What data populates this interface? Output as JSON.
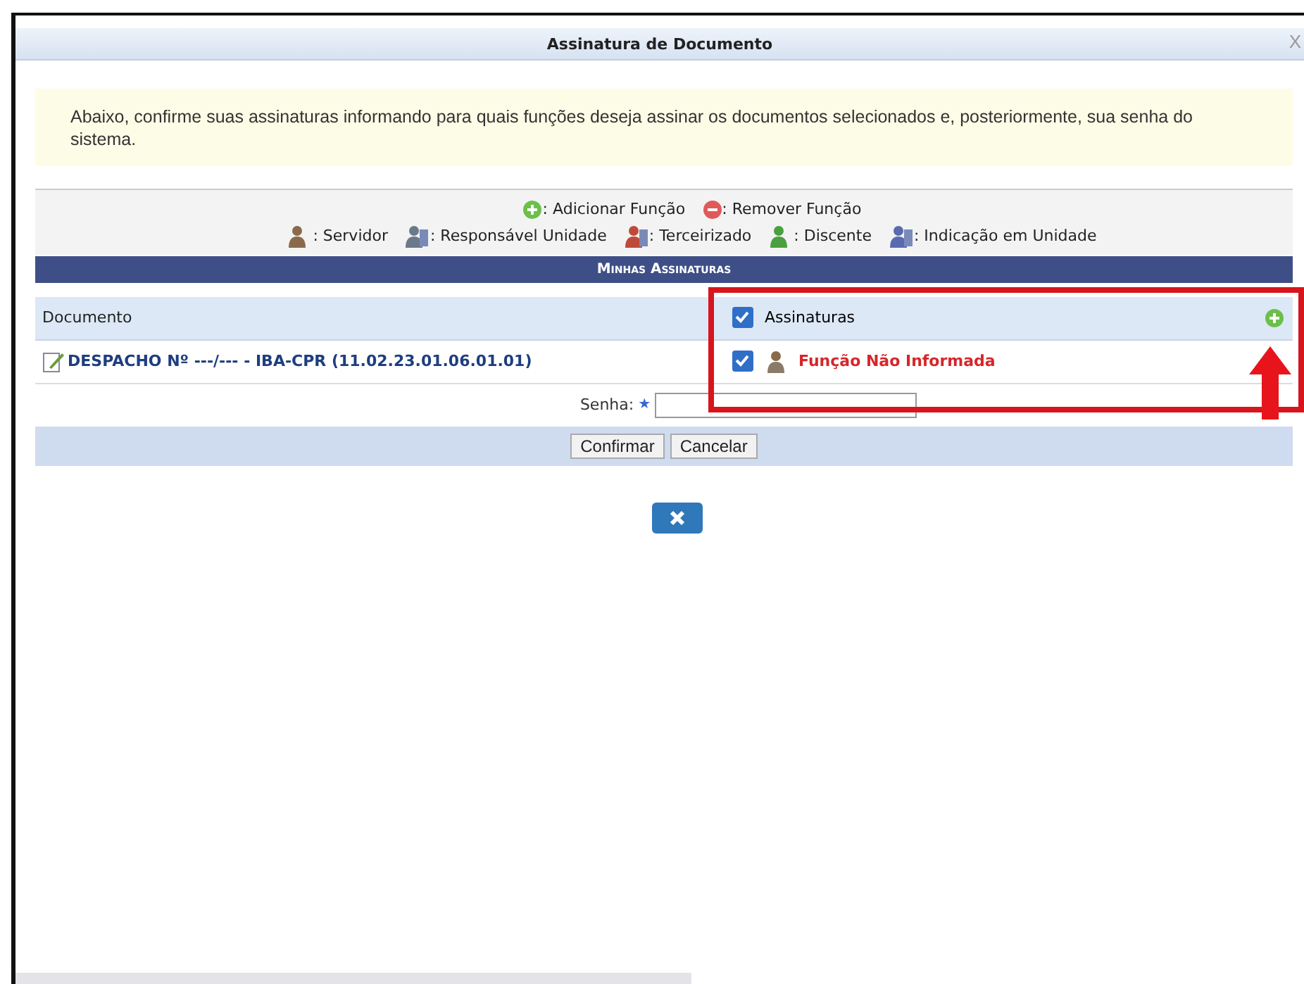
{
  "window": {
    "title": "Assinatura de Documento",
    "close": "X"
  },
  "notice": "Abaixo, confirme suas assinaturas informando para quais funções deseja assinar os documentos selecionados e, posteriormente, sua senha do sistema.",
  "legend": {
    "actions": [
      {
        "kind": "add",
        "label": ": Adicionar Função"
      },
      {
        "kind": "remove",
        "label": ": Remover Função"
      }
    ],
    "roles": [
      {
        "kind": "servidor",
        "label": ": Servidor"
      },
      {
        "kind": "responsavel",
        "label": ": Responsável Unidade"
      },
      {
        "kind": "terceirizado",
        "label": ": Terceirizado"
      },
      {
        "kind": "discente",
        "label": ": Discente"
      },
      {
        "kind": "unidade",
        "label": ": Indicação em Unidade"
      }
    ]
  },
  "caption": "Minhas Assinaturas",
  "table": {
    "columns": [
      "Documento",
      "Assinaturas"
    ],
    "header_checked": true,
    "rows": [
      {
        "document": "DESPACHO Nº ---/--- - IBA-CPR (11.02.23.01.06.01.01)",
        "checked": true,
        "signature": "Função Não Informada"
      }
    ]
  },
  "password": {
    "label": "Senha:",
    "required_marker": "★"
  },
  "buttons": [
    "Confirmar",
    "Cancelar"
  ]
}
